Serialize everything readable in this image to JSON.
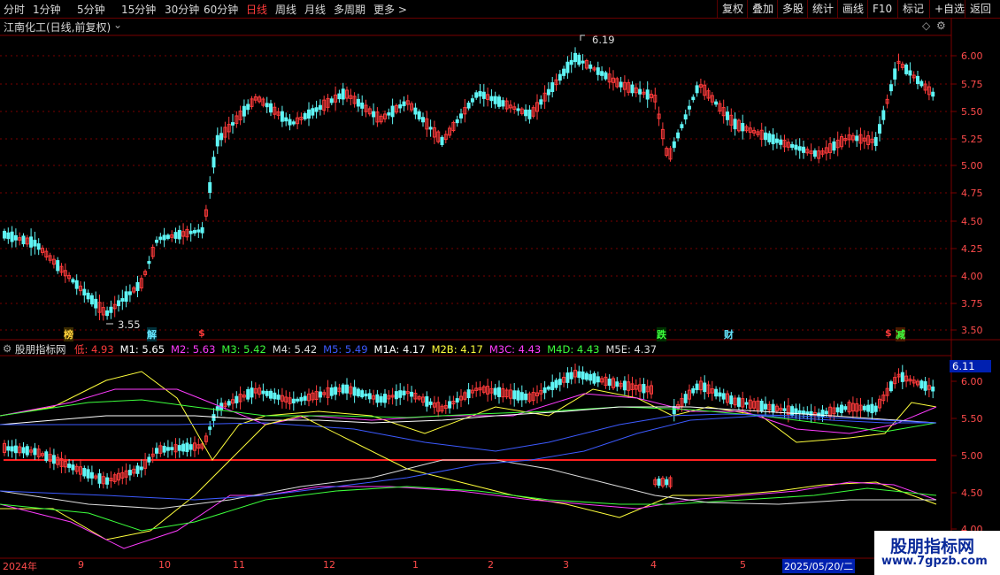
{
  "toolbar": {
    "periods": [
      "分时",
      "1分钟",
      "5分钟",
      "15分钟",
      "30分钟",
      "60分钟",
      "日线",
      "周线",
      "月线",
      "多周期",
      "更多 >"
    ],
    "active": "日线",
    "right": [
      "复权",
      "叠加",
      "多股",
      "统计",
      "画线",
      "F10",
      "标记",
      "+自选",
      "返回"
    ]
  },
  "main": {
    "title": "江南化工(日线,前复权)",
    "high_label": "6.19",
    "low_label": "3.55",
    "yticks": [
      "6.00",
      "5.75",
      "5.50",
      "5.25",
      "5.00",
      "4.75",
      "4.50",
      "4.25",
      "4.00",
      "3.75",
      "3.50"
    ],
    "flags": [
      "榜",
      "解",
      "$",
      "跌",
      "财",
      "$",
      "减"
    ]
  },
  "indicator": {
    "name": "股朋指标网",
    "values": [
      {
        "label": "低: 4.93",
        "color": "#ff3b3b"
      },
      {
        "label": "M1: 5.65",
        "color": "#ffffff"
      },
      {
        "label": "M2: 5.63",
        "color": "#ff3cff"
      },
      {
        "label": "M3: 5.42",
        "color": "#3cff3c"
      },
      {
        "label": "M4: 5.42",
        "color": "#dddddd"
      },
      {
        "label": "M5: 5.49",
        "color": "#3c5aff"
      },
      {
        "label": "M1A: 4.17",
        "color": "#ffffff"
      },
      {
        "label": "M2B: 4.17",
        "color": "#ffff3c"
      },
      {
        "label": "M3C: 4.43",
        "color": "#ff3cff"
      },
      {
        "label": "M4D: 4.43",
        "color": "#3cff3c"
      },
      {
        "label": "M5E: 4.37",
        "color": "#dddddd"
      }
    ],
    "price_box": "6.11",
    "yticks": [
      "6.00",
      "5.50",
      "5.00",
      "4.50",
      "4.00"
    ]
  },
  "xaxis": {
    "labels": [
      "2024年",
      "9",
      "10",
      "11",
      "12",
      "1",
      "2",
      "3",
      "4",
      "5"
    ],
    "cursor_date": "2025/05/20/二"
  },
  "watermark": {
    "title": "股朋指标网",
    "url": "www.7gpzb.com"
  },
  "colors": {
    "up": "#ff3b3b",
    "down": "#5ff5f5",
    "grid": "#7a0000"
  }
}
